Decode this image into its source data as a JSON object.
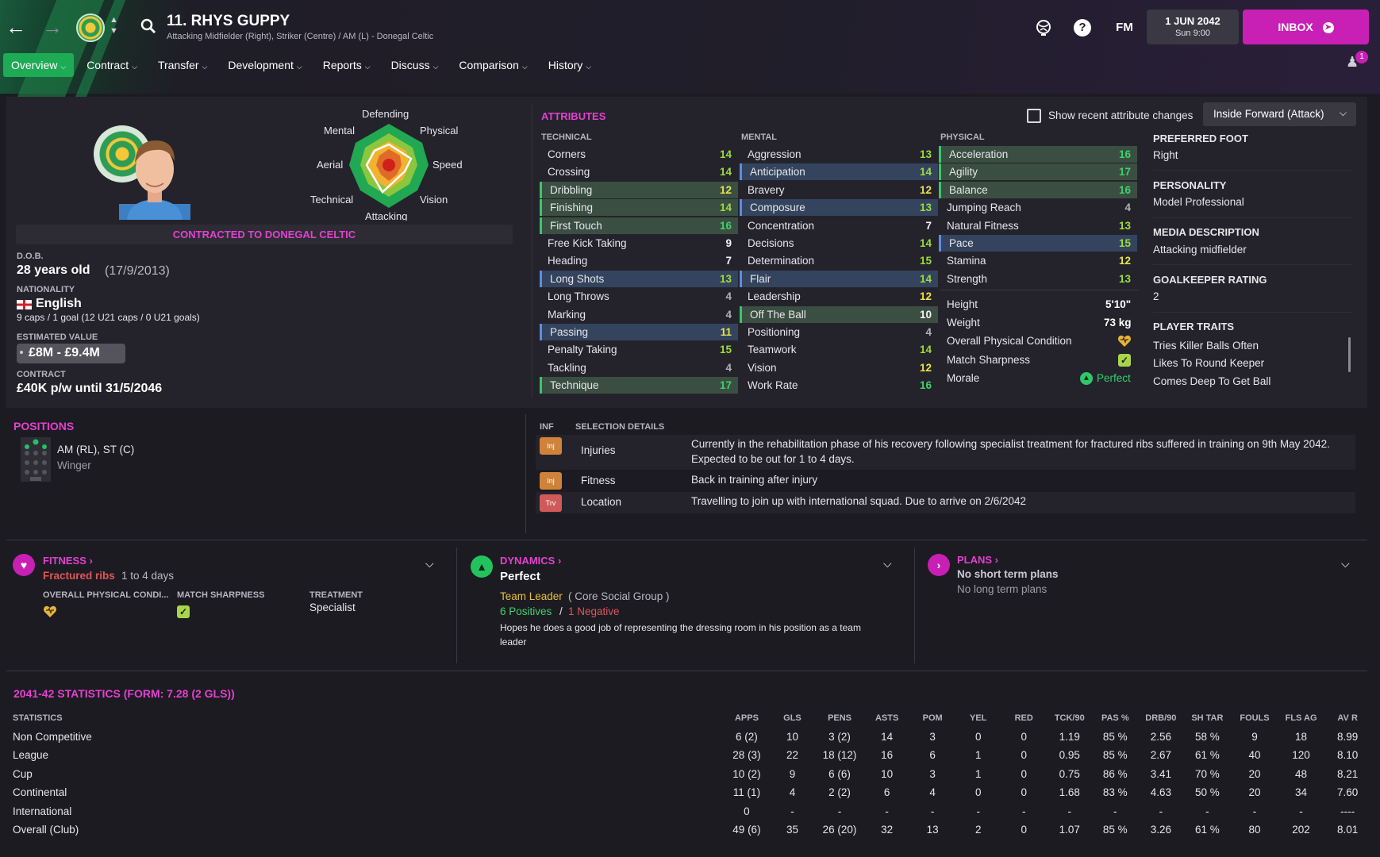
{
  "header": {
    "player_name": "11. RHYS GUPPY",
    "player_subtitle": "Attacking Midfielder (Right), Striker (Centre) / AM (L) - Donegal Celtic",
    "fm_label": "FM",
    "date": "1 JUN 2042",
    "time": "Sun 9:00",
    "inbox_label": "INBOX",
    "notification_count": "1"
  },
  "tabs": [
    {
      "label": "Overview"
    },
    {
      "label": "Contract"
    },
    {
      "label": "Transfer"
    },
    {
      "label": "Development"
    },
    {
      "label": "Reports"
    },
    {
      "label": "Discuss"
    },
    {
      "label": "Comparison"
    },
    {
      "label": "History"
    }
  ],
  "profile": {
    "radar_labels": {
      "top": "Defending",
      "top_left": "Mental",
      "top_right": "Physical",
      "left": "Aerial",
      "right": "Speed",
      "bottom_left": "Technical",
      "bottom_right": "Vision",
      "bottom": "Attacking"
    },
    "contract_banner": "CONTRACTED TO DONEGAL CELTIC",
    "dob_label": "D.O.B.",
    "age": "28 years old",
    "dob": "(17/9/2013)",
    "nationality_label": "NATIONALITY",
    "nationality": "English",
    "caps": "9 caps / 1 goal (12 U21 caps / 0 U21 goals)",
    "value_label": "ESTIMATED VALUE",
    "value": "£8M - £9.4M",
    "contract_label": "CONTRACT",
    "contract": "£40K p/w until 31/5/2046"
  },
  "attributes": {
    "title": "ATTRIBUTES",
    "show_changes_label": "Show recent attribute changes",
    "role_select": "Inside Forward (Attack)",
    "technical_label": "TECHNICAL",
    "mental_label": "MENTAL",
    "physical_label": "PHYSICAL",
    "technical": [
      {
        "name": "Corners",
        "value": "14"
      },
      {
        "name": "Crossing",
        "value": "14"
      },
      {
        "name": "Dribbling",
        "value": "12"
      },
      {
        "name": "Finishing",
        "value": "14"
      },
      {
        "name": "First Touch",
        "value": "16"
      },
      {
        "name": "Free Kick Taking",
        "value": "9"
      },
      {
        "name": "Heading",
        "value": "7"
      },
      {
        "name": "Long Shots",
        "value": "13"
      },
      {
        "name": "Long Throws",
        "value": "4"
      },
      {
        "name": "Marking",
        "value": "4"
      },
      {
        "name": "Passing",
        "value": "11"
      },
      {
        "name": "Penalty Taking",
        "value": "15"
      },
      {
        "name": "Tackling",
        "value": "4"
      },
      {
        "name": "Technique",
        "value": "17"
      }
    ],
    "mental": [
      {
        "name": "Aggression",
        "value": "13"
      },
      {
        "name": "Anticipation",
        "value": "14"
      },
      {
        "name": "Bravery",
        "value": "12"
      },
      {
        "name": "Composure",
        "value": "13"
      },
      {
        "name": "Concentration",
        "value": "7"
      },
      {
        "name": "Decisions",
        "value": "14"
      },
      {
        "name": "Determination",
        "value": "15"
      },
      {
        "name": "Flair",
        "value": "14"
      },
      {
        "name": "Leadership",
        "value": "12"
      },
      {
        "name": "Off The Ball",
        "value": "10"
      },
      {
        "name": "Positioning",
        "value": "4"
      },
      {
        "name": "Teamwork",
        "value": "14"
      },
      {
        "name": "Vision",
        "value": "12"
      },
      {
        "name": "Work Rate",
        "value": "16"
      }
    ],
    "physical": [
      {
        "name": "Acceleration",
        "value": "16"
      },
      {
        "name": "Agility",
        "value": "17"
      },
      {
        "name": "Balance",
        "value": "16"
      },
      {
        "name": "Jumping Reach",
        "value": "4"
      },
      {
        "name": "Natural Fitness",
        "value": "13"
      },
      {
        "name": "Pace",
        "value": "15"
      },
      {
        "name": "Stamina",
        "value": "12"
      },
      {
        "name": "Strength",
        "value": "13"
      }
    ],
    "height_label": "Height",
    "height": "5'10\"",
    "weight_label": "Weight",
    "weight": "73 kg",
    "condition_label": "Overall Physical Condition",
    "sharpness_label": "Match Sharpness",
    "morale_label": "Morale",
    "morale": "Perfect"
  },
  "side_info": {
    "foot_label": "PREFERRED FOOT",
    "foot": "Right",
    "personality_label": "PERSONALITY",
    "personality": "Model Professional",
    "media_label": "MEDIA DESCRIPTION",
    "media": "Attacking midfielder",
    "gk_label": "GOALKEEPER RATING",
    "gk": "2",
    "traits_label": "PLAYER TRAITS",
    "traits": [
      "Tries Killer Balls Often",
      "Likes To Round Keeper",
      "Comes Deep To Get Ball"
    ]
  },
  "positions": {
    "title": "POSITIONS",
    "main": "AM (RL), ST (C)",
    "role": "Winger"
  },
  "selection": {
    "inf_label": "INF",
    "details_label": "SELECTION DETAILS",
    "rows": [
      {
        "tag": "Inj",
        "type": "Injuries",
        "text": "Currently in the rehabilitation phase of his recovery following specialist treatment for fractured ribs suffered in training on 9th May 2042. Expected to be out for 1 to 4 days."
      },
      {
        "tag": "Inj",
        "type": "Fitness",
        "text": "Back in training after injury"
      },
      {
        "tag": "Trv",
        "type": "Location",
        "text": "Travelling to join up with international squad. Due to arrive on 2/6/2042"
      }
    ]
  },
  "fitness": {
    "title": "FITNESS",
    "injury": "Fractured ribs",
    "duration": "1 to 4 days",
    "condition_label": "OVERALL PHYSICAL CONDI...",
    "sharpness_label": "MATCH SHARPNESS",
    "treatment_label": "TREATMENT",
    "treatment": "Specialist"
  },
  "dynamics": {
    "title": "DYNAMICS",
    "status": "Perfect",
    "role": "Team Leader",
    "group": "( Core Social Group )",
    "positives": "6 Positives",
    "separator": "/",
    "negatives": "1 Negative",
    "note": "Hopes he does a good job of representing the dressing room in his position as a team leader"
  },
  "plans": {
    "title": "PLANS",
    "short": "No short term plans",
    "long": "No long term plans"
  },
  "stats": {
    "title": "2041-42 STATISTICS (FORM: 7.28 (2 GLS))",
    "headers": [
      "STATISTICS",
      "APPS",
      "GLS",
      "PENS",
      "ASTS",
      "POM",
      "YEL",
      "RED",
      "TCK/90",
      "PAS %",
      "DRB/90",
      "SH TAR",
      "FOULS",
      "FLS AG",
      "AV R"
    ],
    "rows": [
      [
        "Non Competitive",
        "6 (2)",
        "10",
        "3 (2)",
        "14",
        "3",
        "0",
        "0",
        "1.19",
        "85 %",
        "2.56",
        "58 %",
        "9",
        "18",
        "8.99"
      ],
      [
        "League",
        "28 (3)",
        "22",
        "18 (12)",
        "16",
        "6",
        "1",
        "0",
        "0.95",
        "85 %",
        "2.67",
        "61 %",
        "40",
        "120",
        "8.10"
      ],
      [
        "Cup",
        "10 (2)",
        "9",
        "6 (6)",
        "10",
        "3",
        "1",
        "0",
        "0.75",
        "86 %",
        "3.41",
        "70 %",
        "20",
        "48",
        "8.21"
      ],
      [
        "Continental",
        "11 (1)",
        "4",
        "2 (2)",
        "6",
        "4",
        "0",
        "0",
        "1.68",
        "83 %",
        "4.63",
        "50 %",
        "20",
        "34",
        "7.60"
      ],
      [
        "International",
        "0",
        "-",
        "-",
        "-",
        "-",
        "-",
        "-",
        "-",
        "-",
        "-",
        "-",
        "-",
        "-",
        "----"
      ],
      [
        "Overall (Club)",
        "49 (6)",
        "35",
        "26 (20)",
        "32",
        "13",
        "2",
        "0",
        "1.07",
        "85 %",
        "3.26",
        "61 %",
        "80",
        "202",
        "8.01"
      ]
    ]
  }
}
